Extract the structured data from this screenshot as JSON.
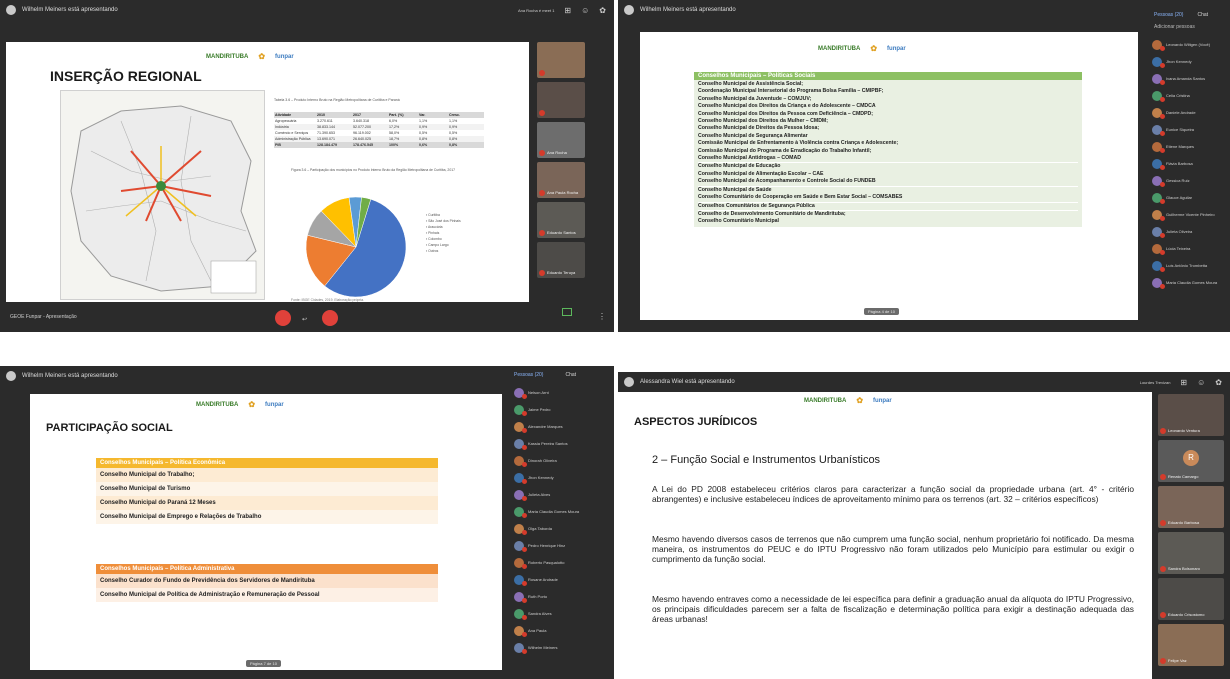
{
  "p1": {
    "presenter": "Wilhelm Meiners está apresentando",
    "presenter_badge": "Ana Rocha é meet 1",
    "title": "INSERÇÃO REGIONAL",
    "logo_left": "MANDIRITUBA",
    "logo_right": "funpar",
    "table_title": "Tabela 3.6 – Produto Interno Bruto na Região Metropolitana de Curitiba e Paraná",
    "table_headers": [
      "Atividade",
      "2010",
      "2017",
      "Part. (%)",
      "Var.",
      "Cresc."
    ],
    "table_rows": [
      [
        "Agropecuária",
        "3.270.611",
        "3.640.318",
        "6,0%",
        "1,1%",
        "1,1%"
      ],
      [
        "Indústria",
        "38.833.144",
        "52.077.200",
        "17,2%",
        "0,9%",
        "0,9%"
      ],
      [
        "Comércio e Serviços",
        "71.390.653",
        "96.119.002",
        "58,0%",
        "0,5%",
        "0,5%"
      ],
      [
        "Administração Pública",
        "13.690.071",
        "26.640.025",
        "18,7%",
        "0,8%",
        "0,8%"
      ],
      [
        "PIB",
        "128.184.479",
        "178.476.545",
        "100%",
        "0,6%",
        "0,8%"
      ]
    ],
    "chart_title": "Figura 3.6 – Participação dos municípios no Produto Interno Bruto da Região Metropolitana de Curitiba, 2017",
    "chart_legend": [
      "Curitiba",
      "São José dos Pinhais",
      "Araucária",
      "Pinhais",
      "Colombo",
      "Campo Largo",
      "Outros"
    ],
    "chart_source": "Fonte: IBGE Cidades, 2019. Elaboração própria.",
    "bottom_left": "GEOE Funpar - Apresentação",
    "participants": [
      {
        "name": ""
      },
      {
        "name": ""
      },
      {
        "name": "Ana Rocha"
      },
      {
        "name": "Ana Paula Rocha"
      },
      {
        "name": "Eduardo Santos"
      },
      {
        "name": "Eduardo Teruya"
      }
    ],
    "chart_data": {
      "type": "pie",
      "categories": [
        "Curitiba",
        "São José dos Pinhais",
        "Araucária",
        "Outros",
        "Pinhais",
        "Colombo"
      ],
      "values": [
        56,
        18,
        9,
        10,
        4,
        3
      ],
      "colors": [
        "#4472c4",
        "#ed7d31",
        "#a5a5a5",
        "#ffc000",
        "#5b9bd5",
        "#70ad47"
      ]
    }
  },
  "p2": {
    "presenter": "Wilhelm Meiners está apresentando",
    "logo_left": "MANDIRITUBA",
    "logo_right": "funpar",
    "table_header": "Conselhos Municipais – Políticas Sociais",
    "rows": [
      "Conselho Municipal de Assistência Social;",
      "Coordenação Municipal Intersetorial do Programa Bolsa Família – CMIPBF;",
      "Conselho Municipal da Juventude – COMJUV;",
      "Conselho Municipal dos Direitos da Criança e do Adolescente – CMDCA",
      "Conselho Municipal dos Direitos da Pessoa com Deficiência – CMDPD;",
      "Conselho Municipal dos Direitos da Mulher – CMDM;",
      "Conselho Municipal de Direitos da Pessoa Idosa;",
      "Conselho Municipal de Segurança Alimentar",
      "Comissão Municipal de Enfrentamento à Violência contra Criança e Adolescente;",
      "Comissão Municipal do Programa de Erradicação do Trabalho Infantil;",
      "Conselho Municipal Antidrogas – COMAD",
      "Conselho Municipal de Educação",
      "Conselho Municipal de Alimentação Escolar – CAE",
      "Conselho Municipal de Acompanhamento e Controle Social do FUNDEB",
      "Conselho Municipal de Saúde",
      "Conselho Comunitário de Cooperação em Saúde e Bem Estar Social – COMSABES",
      "Conselhos Comunitários de Segurança Pública",
      "Conselho de Desenvolvimento Comunitário de Mandirituba;",
      "Conselho Comunitário Municipal"
    ],
    "page_badge": "Página 4 de 10",
    "tab_people": "Pessoas (20)",
    "tab_chat": "Chat",
    "add_people": "Adicionar pessoas",
    "people": [
      "Leonardo Wiltgen (Você)",
      "Jhon Kennedy",
      "Ivana Amanda Santos",
      "Celia Cristina",
      "Daniele Andrade",
      "Eunice Siqueira",
      "Etiene Marques",
      "Flávia Barbosa",
      "Gessica Ruiz",
      "Glauce Aguilar",
      "Guilherme Vicente Pinheiro",
      "Julieta Oliveira",
      "Lúcia Teixeira",
      "Luís Antônio Trombetta",
      "Maria Claudia Gomes Moura"
    ]
  },
  "p3": {
    "presenter": "Wilhelm Meiners está apresentando",
    "title": "PARTICIPAÇÃO SOCIAL",
    "logo_left": "MANDIRITUBA",
    "logo_right": "funpar",
    "section1_header": "Conselhos Municipais – Política Econômica",
    "section1_rows": [
      "Conselho Municipal do Trabalho;",
      "Conselho Municipal de Turismo",
      "Conselho Municipal do Paraná 12 Meses",
      "Conselho Municipal de Emprego e Relações de Trabalho"
    ],
    "section2_header": "Conselhos Municipais – Política Administrativa",
    "section2_rows": [
      "Conselho Curador do Fundo de Previdência dos Servidores de Mandirituba",
      "Conselho Municipal de Política de Administração e Remuneração de Pessoal"
    ],
    "page_badge": "Página 7 de 10",
    "tab_people": "Pessoas (20)",
    "tab_chat": "Chat",
    "people": [
      "Nelson Arnt",
      "Jaime Pedro",
      "Alexandre Marques",
      "Kassia Pereira Santos",
      "Dinorah Oliveira",
      "Jhon Kennedy",
      "Julieta Alves",
      "Maria Claudia Gomes Moura",
      "Olga Taborda",
      "Pedro Henrique Hinz",
      "Roberto Pasqualotto",
      "Rosane Andrade",
      "Ruth Porto",
      "Sandra Alves",
      "Ana Paula",
      "Wilhelm Meiners"
    ]
  },
  "p4": {
    "presenter": "Alessandra Wiel está apresentando",
    "presenter_badge": "Lourdes Trevizan",
    "title": "ASPECTOS JURÍDICOS",
    "logo_left": "MANDIRITUBA",
    "logo_right": "funpar",
    "subtitle": "2 – Função Social e Instrumentos Urbanísticos",
    "para1": "A Lei do PD 2008 estabeleceu critérios claros para caracterizar a função social da propriedade urbana (art. 4° - critério abrangentes) e inclusive estabeleceu índices de aproveitamento mínimo para os terrenos (art. 32 – critérios específicos)",
    "para2": "Mesmo havendo diversos casos de terrenos que não cumprem uma função social, nenhum proprietário foi notificado. Da mesma maneira, os instrumentos do PEUC e do IPTU Progressivo não foram utilizados pelo Município para estimular ou exigir o cumprimento da função social.",
    "para3": "Mesmo havendo entraves como a necessidade de lei específica para definir a graduação anual da alíquota do IPTU Progressivo, os principais dificuldades parecem ser a falta de fiscalização e determinação política para exigir a destinação adequada das áreas urbanas!",
    "participants": [
      {
        "name": "Leonardo Ventura"
      },
      {
        "name": "Renato Camargo"
      },
      {
        "name": "Eduardo Barbosa"
      },
      {
        "name": "Sandra Bolsonaro"
      },
      {
        "name": "Eduardo Crisostomo"
      },
      {
        "name": "Felipe Vaz"
      }
    ]
  }
}
